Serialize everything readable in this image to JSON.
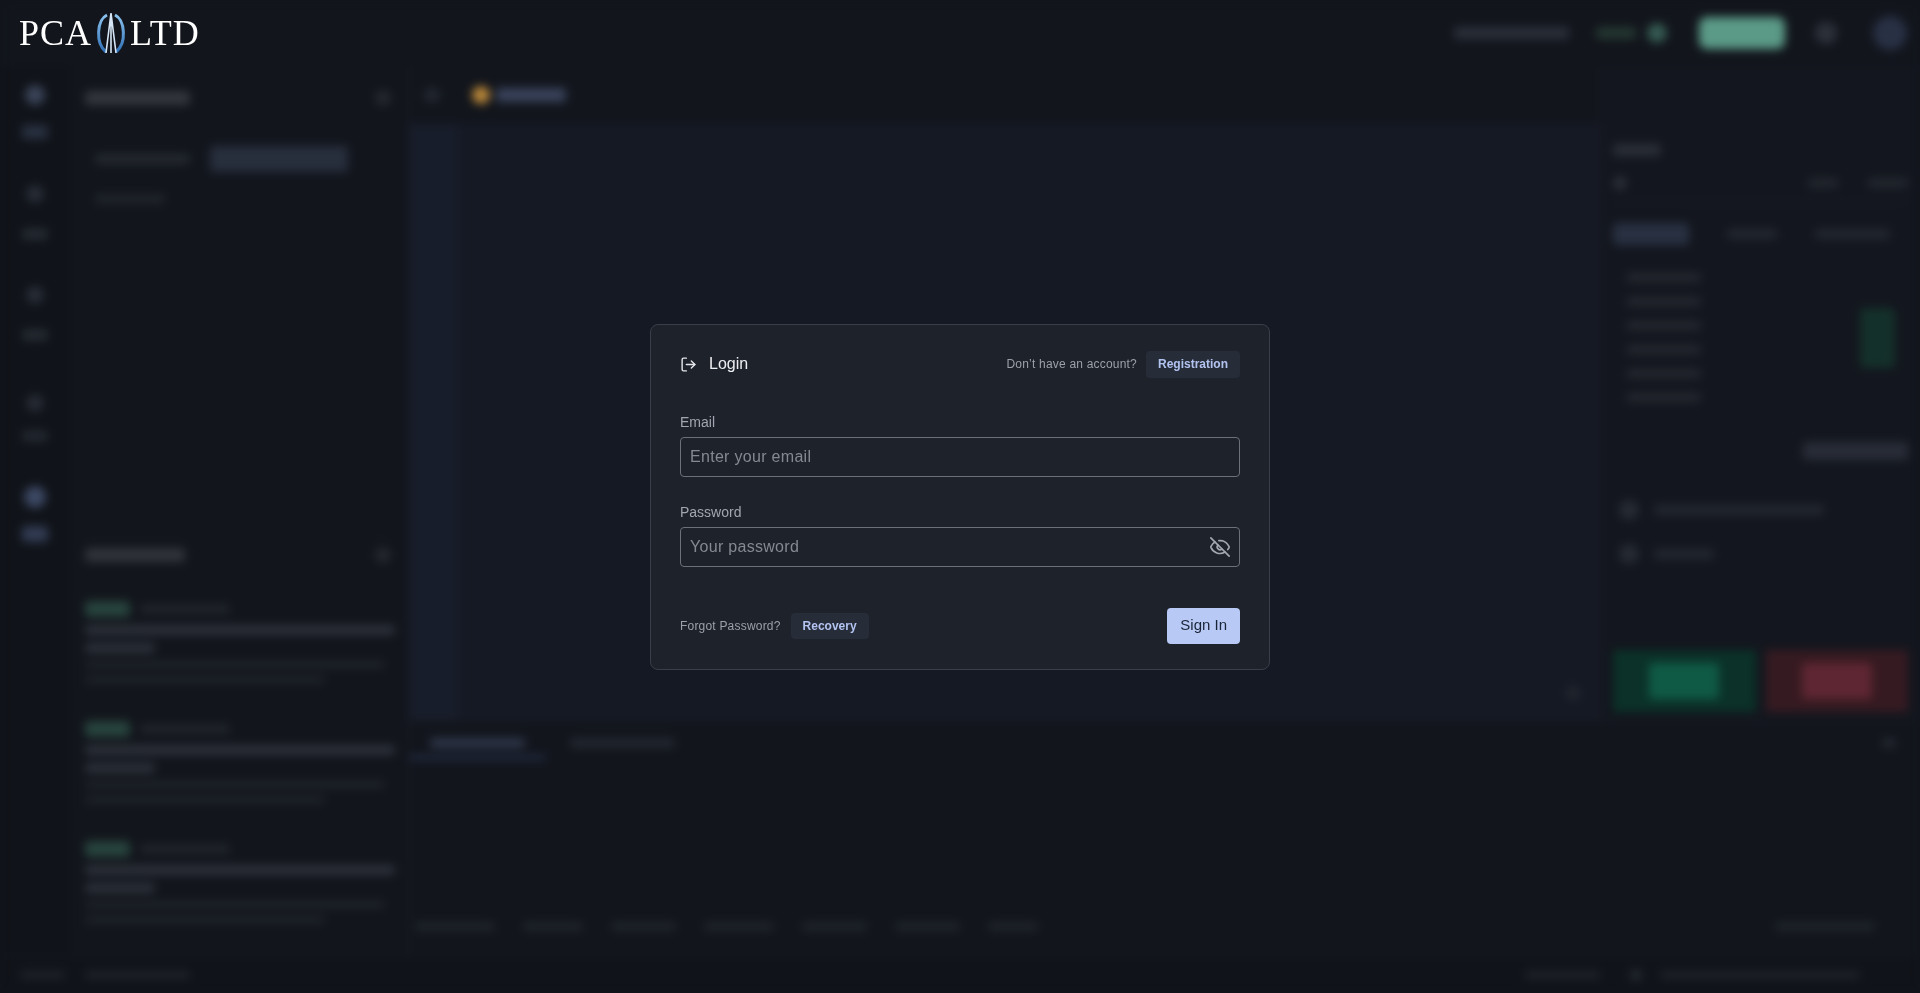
{
  "logo": {
    "left_text": "PCA",
    "right_text": "LTD"
  },
  "login_dialog": {
    "title": "Login",
    "account_prompt": "Don’t have an account?",
    "registration_button": "Registration",
    "fields": [
      {
        "kind": "email",
        "label": "Email",
        "placeholder": "Enter your email"
      },
      {
        "kind": "password",
        "label": "Password",
        "placeholder": "Your password"
      }
    ],
    "recovery_prompt": "Forgot Password?",
    "recovery_button": "Recovery",
    "submit_button": "Sign In"
  }
}
